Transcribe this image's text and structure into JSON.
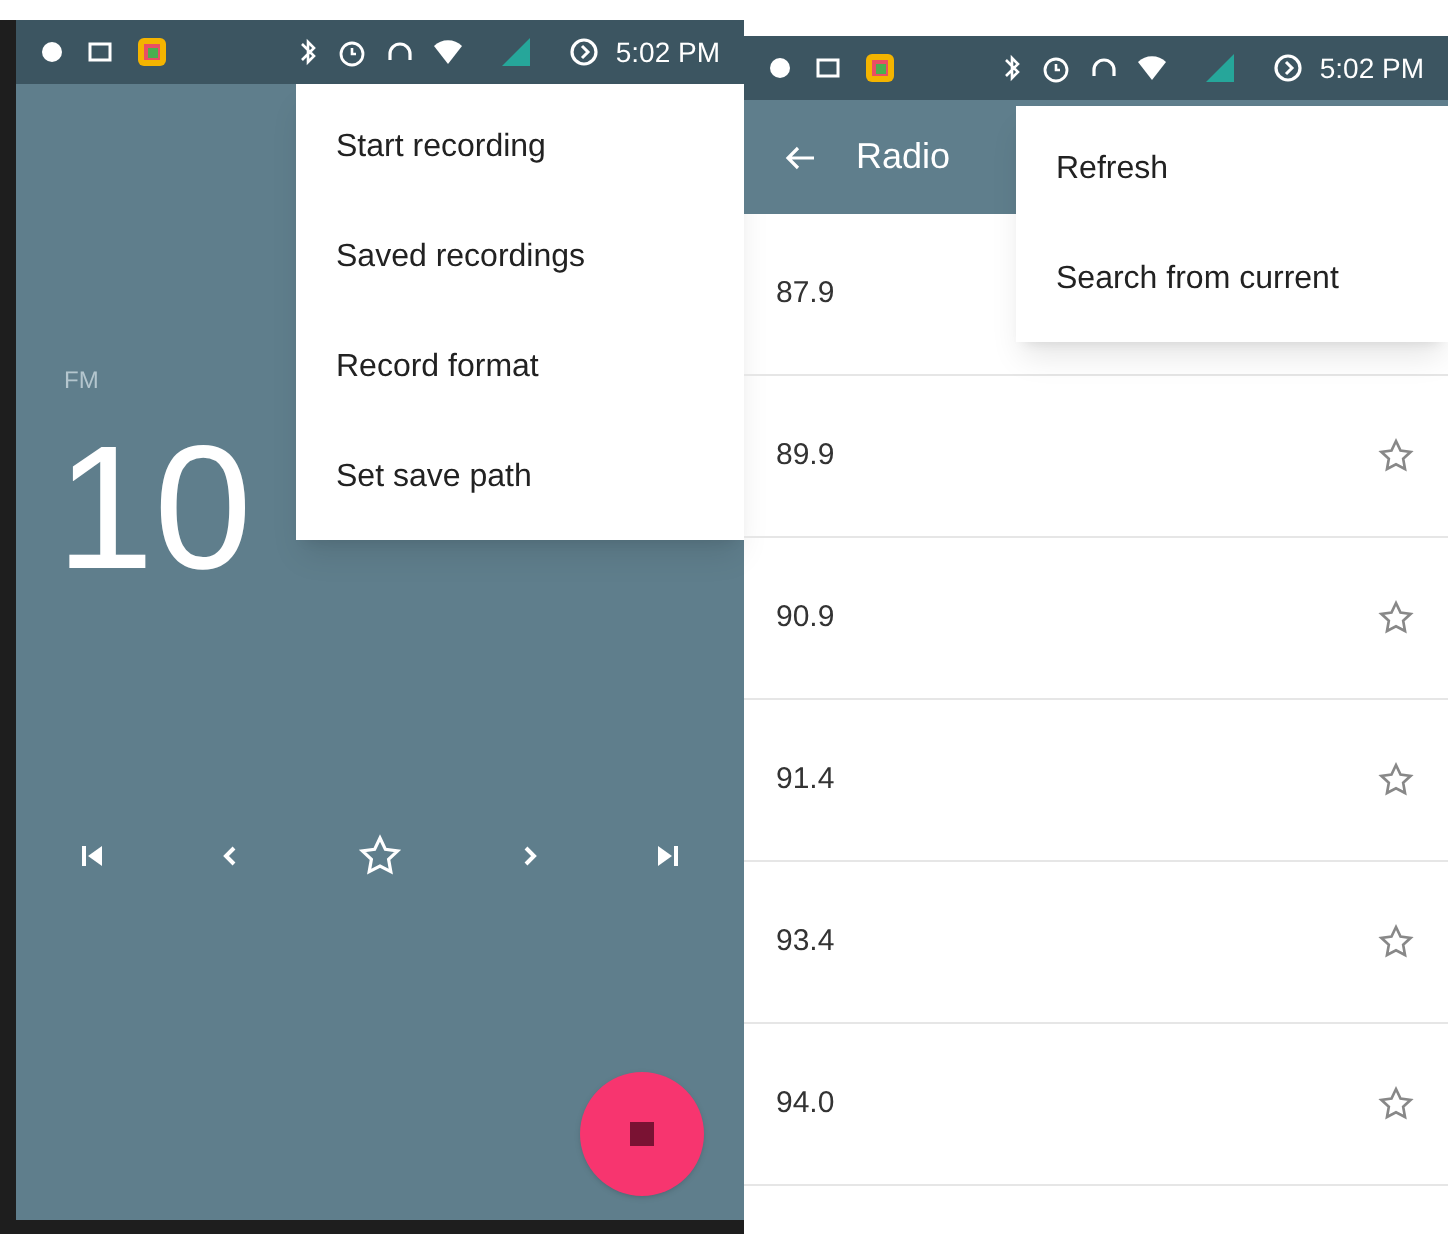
{
  "player_screen": {
    "status_bar": {
      "time": "5:02 PM"
    },
    "band": "FM",
    "frequency": "10",
    "controls": {
      "favorite": false
    },
    "recording": true,
    "menu": [
      "Start recording",
      "Saved recordings",
      "Record format",
      "Set save path"
    ]
  },
  "stations_screen": {
    "status_bar": {
      "time": "5:02 PM"
    },
    "title": "Radio",
    "menu": [
      "Refresh",
      "Search from current"
    ],
    "stations": [
      {
        "frequency": "87.9"
      },
      {
        "frequency": "89.9",
        "favorite": false
      },
      {
        "frequency": "90.9",
        "favorite": false
      },
      {
        "frequency": "91.4",
        "favorite": false
      },
      {
        "frequency": "93.4",
        "favorite": false
      },
      {
        "frequency": "94.0",
        "favorite": false
      }
    ]
  }
}
